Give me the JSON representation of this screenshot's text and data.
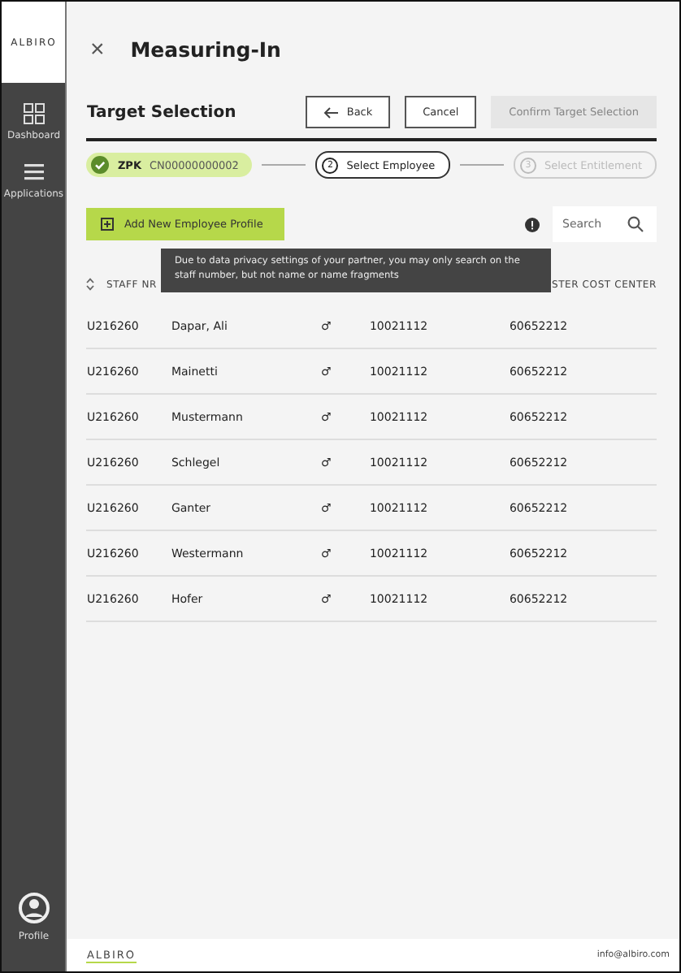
{
  "sidebar": {
    "logo": "ALBIRO",
    "items": [
      {
        "label": "Dashboard",
        "kind": "grid"
      },
      {
        "label": "Applications",
        "kind": "menu"
      }
    ],
    "profile": {
      "label": "Profile"
    }
  },
  "header": {
    "close": "×",
    "title": "Measuring-In"
  },
  "section": {
    "title": "Target Selection",
    "buttons": [
      {
        "label": "Back",
        "kind": "back",
        "disabled": false
      },
      {
        "label": "Cancel",
        "kind": "plain",
        "disabled": false
      },
      {
        "label": "Confirm Target Selection",
        "kind": "primary",
        "disabled": true
      }
    ]
  },
  "steps": [
    {
      "kind": "done",
      "code": "ZPK",
      "label": "CN00000000002"
    },
    {
      "kind": "current",
      "number": "2",
      "label": "Select Employee"
    },
    {
      "kind": "pending",
      "number": "3",
      "label": "Select Entitlement"
    }
  ],
  "add_button": {
    "label": "Add New Employee Profile"
  },
  "search": {
    "placeholder": "Search"
  },
  "tooltip": "Due to data privacy settings of your partner, you may only search on the staff number, but not name or name fragments",
  "table": {
    "columns": [
      {
        "label": "STAFF NR",
        "sortable": true
      },
      {
        "label": "STER COST CENTER",
        "sortable": false
      }
    ],
    "rows": [
      {
        "staff_nr": "U216260",
        "name": "Dapar, Ali",
        "gender": "♂",
        "number": "10021112",
        "cost_center": "60652212"
      },
      {
        "staff_nr": "U216260",
        "name": "Mainetti",
        "gender": "♂",
        "number": "10021112",
        "cost_center": "60652212"
      },
      {
        "staff_nr": "U216260",
        "name": "Mustermann",
        "gender": "♂",
        "number": "10021112",
        "cost_center": "60652212"
      },
      {
        "staff_nr": "U216260",
        "name": "Schlegel",
        "gender": "♂",
        "number": "10021112",
        "cost_center": "60652212"
      },
      {
        "staff_nr": "U216260",
        "name": "Ganter",
        "gender": "♂",
        "number": "10021112",
        "cost_center": "60652212"
      },
      {
        "staff_nr": "U216260",
        "name": "Westermann",
        "gender": "♂",
        "number": "10021112",
        "cost_center": "60652212"
      },
      {
        "staff_nr": "U216260",
        "name": "Hofer",
        "gender": "♂",
        "number": "10021112",
        "cost_center": "60652212"
      }
    ]
  },
  "footer": {
    "logo": "ALBIRO",
    "email": "info@albiro.com"
  }
}
